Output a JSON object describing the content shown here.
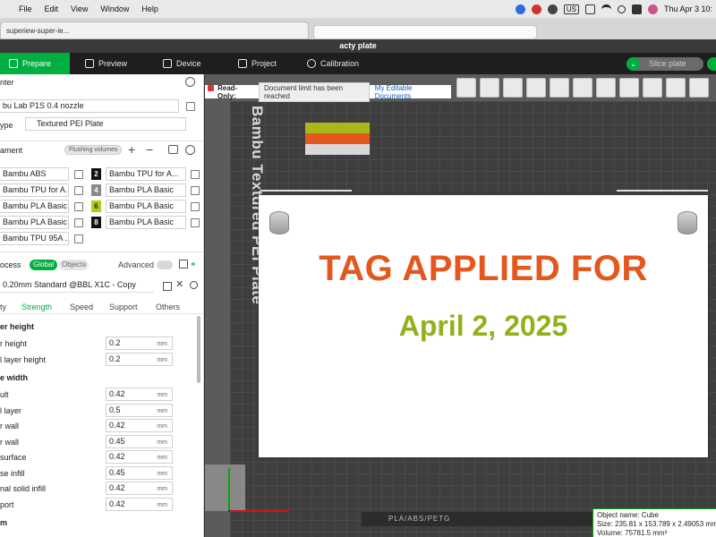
{
  "menubar": {
    "items": [
      "File",
      "Edit",
      "View",
      "Window",
      "Help"
    ],
    "input_indicator": "US",
    "datetime": "Thu Apr 3  10:"
  },
  "browser": {
    "tab_title": "superiew-super-ie..."
  },
  "window": {
    "title": "acty plate"
  },
  "toolbar": {
    "tabs": [
      {
        "label": "Prepare",
        "icon": "cube-icon"
      },
      {
        "label": "Preview",
        "icon": "layers-icon"
      },
      {
        "label": "Device",
        "icon": "device-icon"
      },
      {
        "label": "Project",
        "icon": "project-icon"
      },
      {
        "label": "Calibration",
        "icon": "calibration-icon"
      }
    ],
    "slice_label": "Slice plate"
  },
  "printer": {
    "section": "nter",
    "printer_value": "bu Lab P1S 0.4 nozzle",
    "plate_label": "ype",
    "plate_value": "Textured PEI Plate"
  },
  "filament": {
    "section": "ament",
    "flushing_label": "Flushing volumes",
    "slots": [
      {
        "name": "Bambu ABS",
        "num": "",
        "color": "#ffffff"
      },
      {
        "name": "Bambu TPU for A...",
        "num": "2",
        "color": "#111111"
      },
      {
        "name": "Bambu TPU for A...",
        "num": "",
        "color": "#ffffff"
      },
      {
        "name": "Bambu PLA Basic",
        "num": "4",
        "color": "#8a8a8a"
      },
      {
        "name": "Bambu PLA Basic",
        "num": "",
        "color": "#ffffff"
      },
      {
        "name": "Bambu PLA Basic",
        "num": "6",
        "color": "#b8c81a"
      },
      {
        "name": "Bambu PLA Basic",
        "num": "",
        "color": "#ffffff"
      },
      {
        "name": "Bambu PLA Basic",
        "num": "8",
        "color": "#111111"
      },
      {
        "name": "Bambu TPU 95A ...",
        "num": "",
        "color": "#ffffff"
      }
    ]
  },
  "process": {
    "section": "ocess",
    "global_label": "Global",
    "objects_label": "Objects",
    "advanced_label": "Advanced",
    "preset": "0.20mm Standard @BBL X1C - Copy",
    "subtabs": [
      "ty",
      "Strength",
      "Speed",
      "Support",
      "Others"
    ],
    "groups": [
      {
        "title": "er height",
        "params": [
          {
            "label": "r height",
            "value": "0.2",
            "unit": "mm"
          },
          {
            "label": "l layer height",
            "value": "0.2",
            "unit": "mm"
          }
        ]
      },
      {
        "title": "e width",
        "params": [
          {
            "label": "ult",
            "value": "0.42",
            "unit": "mm"
          },
          {
            "label": "l layer",
            "value": "0.5",
            "unit": "mm"
          },
          {
            "label": "r wall",
            "value": "0.42",
            "unit": "mm"
          },
          {
            "label": "r wall",
            "value": "0.45",
            "unit": "mm"
          },
          {
            "label": "surface",
            "value": "0.42",
            "unit": "mm"
          },
          {
            "label": "se infill",
            "value": "0.45",
            "unit": "mm"
          },
          {
            "label": "nal solid infill",
            "value": "0.42",
            "unit": "mm"
          },
          {
            "label": "port",
            "value": "0.42",
            "unit": "mm"
          }
        ]
      },
      {
        "title": "m",
        "params": []
      }
    ]
  },
  "viewport": {
    "readonly_label": "Read-Only:",
    "readonly_msg": "Document limit has been reached",
    "readonly_link": "My Editable Documents",
    "bed_label": "Bambu Textured PEI Plate",
    "swatch_colors": [
      "#a8b81a",
      "#e4571d",
      "#d8d8d8"
    ],
    "tag_text": "TAG APPLIED FOR",
    "tag_date": "April 2, 2025",
    "bottom_strip": "PLA/ABS/PETG",
    "object_info": {
      "name": "Object name: Cube",
      "size": "Size: 235.81 x 153.789 x 2.49053 mm",
      "volume": "Volume: 75781.5 mm³"
    }
  }
}
